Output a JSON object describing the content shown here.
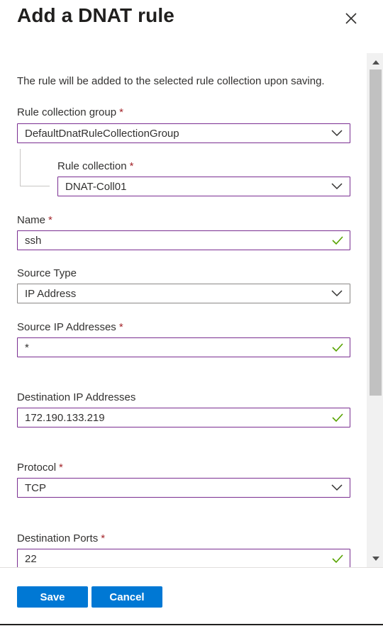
{
  "panel": {
    "title": "Add a DNAT rule",
    "description": "The rule will be added to the selected rule collection upon saving."
  },
  "required_marker": "*",
  "fields": {
    "rule_collection_group": {
      "label": "Rule collection group",
      "value": "DefaultDnatRuleCollectionGroup",
      "required": true
    },
    "rule_collection": {
      "label": "Rule collection",
      "value": "DNAT-Coll01",
      "required": true
    },
    "name": {
      "label": "Name",
      "value": "ssh",
      "required": true,
      "valid": true
    },
    "source_type": {
      "label": "Source Type",
      "value": "IP Address",
      "required": false
    },
    "source_ip_addresses": {
      "label": "Source IP Addresses",
      "value": "*",
      "required": true,
      "valid": true
    },
    "destination_ip_addresses": {
      "label": "Destination IP Addresses",
      "value": "172.190.133.219",
      "required": false,
      "valid": true
    },
    "protocol": {
      "label": "Protocol",
      "value": "TCP",
      "required": true
    },
    "destination_ports": {
      "label": "Destination Ports",
      "value": "22",
      "required": true,
      "valid": true
    }
  },
  "footer": {
    "save_label": "Save",
    "cancel_label": "Cancel"
  },
  "icons": {
    "close": "close-icon",
    "dropdown": "chevron-down-icon",
    "valid": "checkmark-icon"
  },
  "colors": {
    "primary_button": "#0078d4",
    "required_asterisk": "#a4262c",
    "valid_check": "#57a300",
    "focused_border": "#7a2e91",
    "default_border": "#8a8886"
  }
}
